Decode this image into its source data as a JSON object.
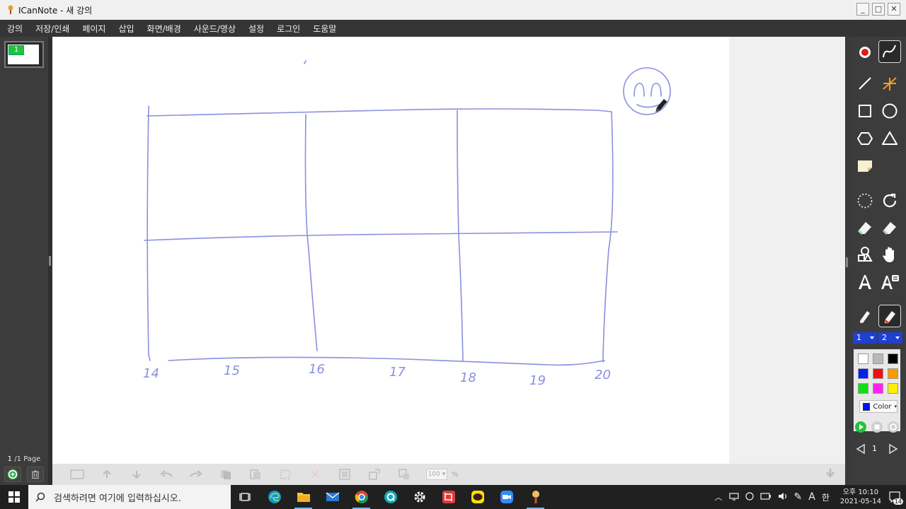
{
  "window": {
    "title": "ICanNote - 새 강의",
    "controls": [
      "_",
      "□",
      "✕"
    ]
  },
  "menu": [
    "강의",
    "저장/인쇄",
    "페이지",
    "삽입",
    "화면/배경",
    "사운드/영상",
    "설정",
    "로그인",
    "도움말"
  ],
  "pages": {
    "thumb_label": "1",
    "current": "1",
    "total_text": "/1 Page"
  },
  "bottom_toolbar": {
    "zoom": "100",
    "zoom_unit": "%"
  },
  "drawing": {
    "pen_color": "#8b8fe0",
    "axis_labels": [
      "14",
      "15",
      "16",
      "17",
      "18",
      "19",
      "20"
    ]
  },
  "tools": {
    "pen_width_1": "1",
    "pen_width_2": "2",
    "page_number": "1",
    "color_button": "Color",
    "palette": [
      "#ffffff",
      "#b8b8b8",
      "#000000",
      "#0022ee",
      "#ee1111",
      "#ff9900",
      "#11dd11",
      "#ff22ee",
      "#ffee00"
    ]
  },
  "taskbar": {
    "search_placeholder": "검색하려면 여기에 입력하십시오.",
    "apps": [
      "task-view",
      "edge",
      "file-explorer",
      "mail",
      "chrome",
      "q-app",
      "settings",
      "screen-capture",
      "kakaotalk",
      "zoom",
      "icannote"
    ],
    "tray_lang": "한",
    "time": "오후 10:10",
    "date": "2021-05-14",
    "notifications": "14"
  }
}
